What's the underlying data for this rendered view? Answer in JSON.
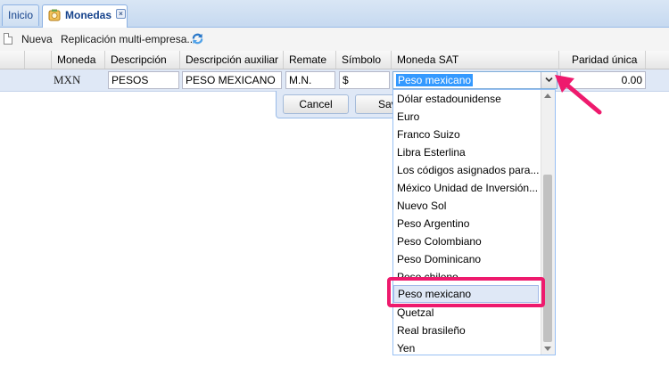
{
  "tabs": [
    {
      "label": "Inicio"
    },
    {
      "label": "Monedas"
    }
  ],
  "toolbar": {
    "new_label": "Nueva",
    "replicate_label": "Replicación multi-empresa..."
  },
  "grid": {
    "columns": [
      "Moneda",
      "Descripción",
      "Descripción auxiliar",
      "Remate",
      "Símbolo",
      "Moneda SAT",
      "Paridad única"
    ],
    "row": {
      "moneda": "MXN",
      "descripcion": "PESOS",
      "descripcion_auxiliar": "PESO MEXICANO",
      "remate": "M.N.",
      "simbolo": "$",
      "moneda_sat": "Peso mexicano",
      "paridad": "0.00"
    }
  },
  "buttons": {
    "cancel": "Cancel",
    "save": "Sav"
  },
  "dropdown": {
    "items": [
      "Dólar estadounidense",
      "Euro",
      "Franco Suizo",
      "Libra Esterlina",
      "Los códigos asignados para...",
      "México Unidad de Inversión...",
      "Nuevo Sol",
      "Peso Argentino",
      "Peso Colombiano",
      "Peso Dominicano",
      "Peso chileno",
      "Peso mexicano",
      "Quetzal",
      "Real brasileño",
      "Yen"
    ],
    "selected_index": 11
  },
  "colors": {
    "accent_blue": "#3399ff",
    "annotation_pink": "#ee1a6d",
    "header_blue": "#15428b"
  },
  "icons": {
    "tab_icon": "currency-bag-icon",
    "new_icon": "document-icon",
    "refresh_icon": "refresh-icon"
  }
}
